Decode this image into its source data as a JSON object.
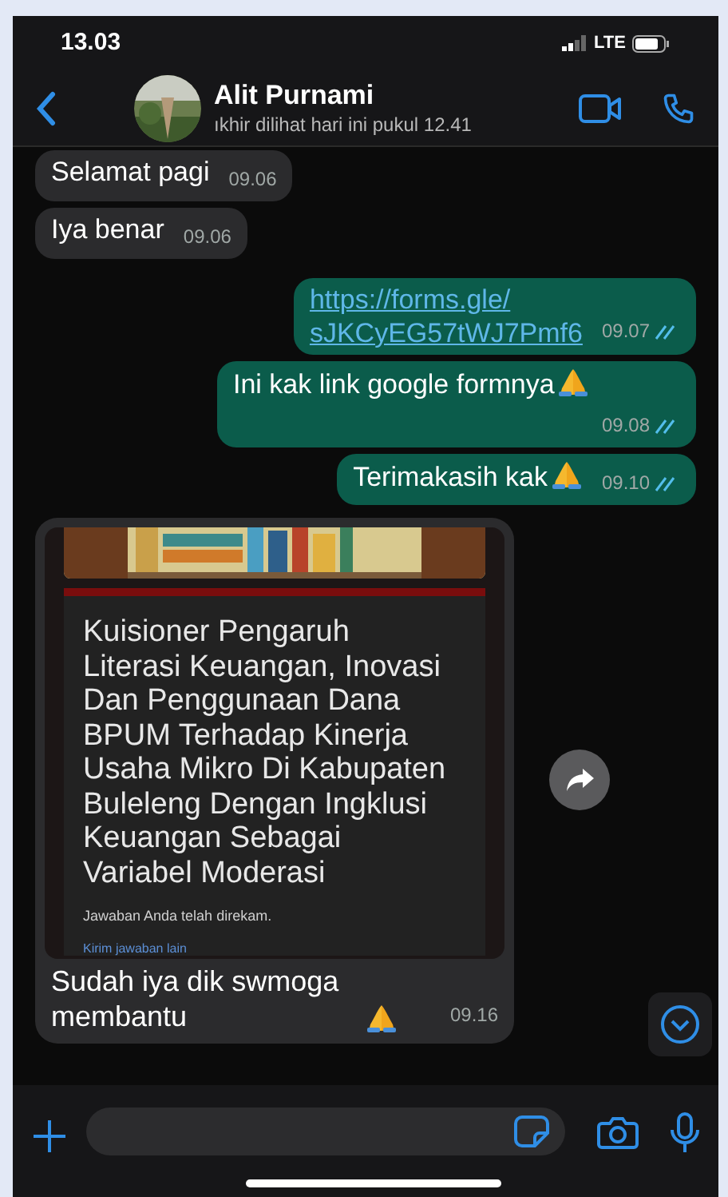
{
  "status_bar": {
    "time": "13.03",
    "network": "LTE"
  },
  "header": {
    "contact_name": "Alit Purnami",
    "last_seen": "ıkhir dilihat hari ini pukul 12.41"
  },
  "messages": [
    {
      "kind": "text",
      "outgoing": false,
      "text": "Selamat pagi",
      "time": "09.06",
      "emoji": false
    },
    {
      "kind": "text",
      "outgoing": false,
      "text": "Iya benar",
      "time": "09.06",
      "emoji": false
    },
    {
      "kind": "link",
      "outgoing": true,
      "text": "https://forms.gle/ sJKCyEG57tWJ7Pmf6",
      "time": "09.07",
      "read": true,
      "emoji": false
    },
    {
      "kind": "text",
      "outgoing": true,
      "text": "Ini kak link google formnya",
      "time": "09.08",
      "read": true,
      "emoji": true
    },
    {
      "kind": "text",
      "outgoing": true,
      "text": "Terimakasih kak",
      "time": "09.10",
      "read": true,
      "emoji": true
    },
    {
      "outgoing": false,
      "image": {
        "kind": "picture",
        "form_title": "Kuisioner Pengaruh Literasi Keuangan, Inovasi Dan Penggunaan Dana BPUM Terhadap Kinerja Usaha Mikro Di Kabupaten Buleleng Dengan Ingklusi Keuangan Sebagai Variabel Moderasi",
        "form_note": "Jawaban Anda telah direkam.",
        "form_link": "Kirim jawaban lain"
      },
      "text": "Sudah iya dik swmoga membantu",
      "time": "09.16",
      "emoji": true
    }
  ]
}
